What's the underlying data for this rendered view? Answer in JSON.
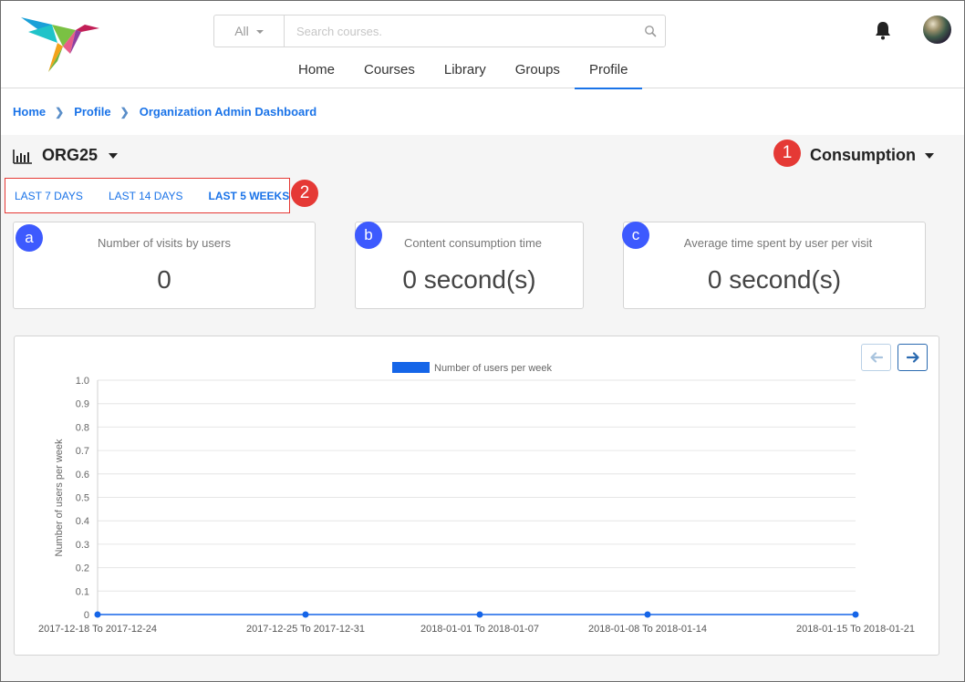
{
  "header": {
    "search": {
      "filter_label": "All",
      "placeholder": "Search courses."
    },
    "nav": [
      {
        "label": "Home"
      },
      {
        "label": "Courses"
      },
      {
        "label": "Library"
      },
      {
        "label": "Groups"
      },
      {
        "label": "Profile",
        "active": true
      }
    ]
  },
  "breadcrumb": [
    "Home",
    "Profile",
    "Organization Admin Dashboard"
  ],
  "org": {
    "name": "ORG25"
  },
  "view_selector": {
    "label": "Consumption",
    "badge": "1"
  },
  "date_range": {
    "badge": "2",
    "options": [
      {
        "label": "LAST 7 DAYS",
        "active": false
      },
      {
        "label": "LAST 14 DAYS",
        "active": false
      },
      {
        "label": "LAST 5 WEEKS",
        "active": true
      }
    ]
  },
  "stats": [
    {
      "badge": "a",
      "label": "Number of visits by users",
      "value": "0"
    },
    {
      "badge": "b",
      "label": "Content consumption time",
      "value": "0 second(s)"
    },
    {
      "badge": "c",
      "label": "Average time spent by user per visit",
      "value": "0 second(s)"
    }
  ],
  "colors": {
    "accent": "#1a73e8",
    "series": "#1565e8",
    "annotation_red": "#e53935",
    "annotation_blue": "#3d5afe"
  },
  "chart_data": {
    "type": "line",
    "ylabel": "Number of users per week",
    "xlabel": "",
    "ylim": [
      0,
      1.0
    ],
    "y_ticks": [
      0,
      0.1,
      0.2,
      0.3,
      0.4,
      0.5,
      0.6,
      0.7,
      0.8,
      0.9,
      1.0
    ],
    "categories": [
      "2017-12-18 To 2017-12-24",
      "2017-12-25 To 2017-12-31",
      "2018-01-01 To 2018-01-07",
      "2018-01-08 To 2018-01-14",
      "2018-01-15 To 2018-01-21"
    ],
    "series": [
      {
        "name": "Number of users per week",
        "values": [
          0,
          0,
          0,
          0,
          0
        ]
      }
    ],
    "legend": "top-center",
    "grid": true
  }
}
